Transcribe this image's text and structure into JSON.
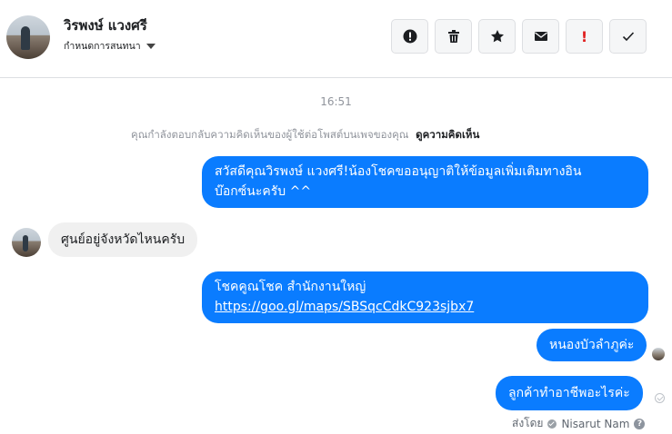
{
  "header": {
    "name": "วิรพงษ์ แวงศรี",
    "subtitle": "กำหนดการสนทนา",
    "actions": [
      {
        "icon": "alert-circle-icon"
      },
      {
        "icon": "trash-icon"
      },
      {
        "icon": "star-icon"
      },
      {
        "icon": "envelope-icon"
      },
      {
        "icon": "exclamation-icon",
        "label": "!"
      },
      {
        "icon": "checkmark-icon"
      }
    ]
  },
  "conversation": {
    "timestamp": "16:51",
    "notice_text": "คุณกำลังตอบกลับความคิดเห็นของผู้ใช้ต่อโพสต์บนเพจของคุณ",
    "notice_link": "ดูความคิดเห็น",
    "messages": [
      {
        "from": "page",
        "lines": [
          "สวัสดีคุณวิรพงษ์ แวงศรี!น้องโชคขออนุญาติให้ข้อมูลเพิ่มเติมทางอิน",
          "บ๊อกซ์นะครับ ^^"
        ]
      },
      {
        "from": "user",
        "text": "ศูนย์อยู่จังหวัดไหนครับ"
      },
      {
        "from": "page",
        "line1": "โชคคูณโชค สำนักงานใหญ่",
        "link": "https://goo.gl/maps/SBSqcCdkC923sjbx7"
      },
      {
        "from": "user_reply",
        "text": "หนองบัวลำภูค่ะ"
      },
      {
        "from": "page",
        "text": "ลูกค้าทำอาชีพอะไรค่ะ"
      }
    ],
    "sent_by_label": "ส่งโดย",
    "sent_by_name": "Nisarut Nam"
  },
  "colors": {
    "outgoing_bubble": "#0a7cff",
    "incoming_bubble": "#f0f0f0",
    "bang": "#e02020"
  }
}
